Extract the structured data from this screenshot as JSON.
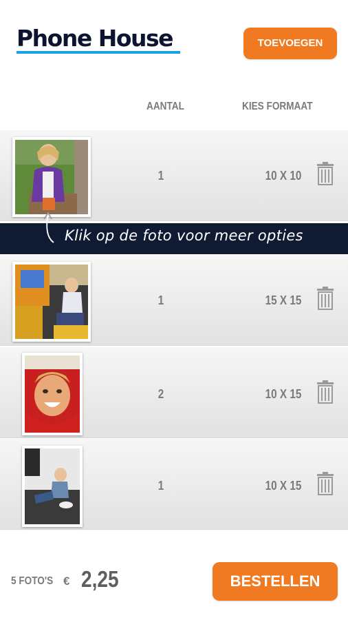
{
  "header": {
    "logo_text": "Phone House",
    "add_button_label": "TOEVOEGEN"
  },
  "columns": {
    "quantity": "AANTAL",
    "format": "KIES FORMAAT"
  },
  "hint": "Klik op de foto voor meer opties",
  "items": [
    {
      "quantity": "1",
      "format": "10 X 10",
      "photo": "girl-purple-jacket"
    },
    {
      "quantity": "1",
      "format": "15 X 15",
      "photo": "child-arcade-game"
    },
    {
      "quantity": "2",
      "format": "10 X 15",
      "photo": "child-red-hood"
    },
    {
      "quantity": "1",
      "format": "10 X 15",
      "photo": "toddler-on-floor"
    }
  ],
  "footer": {
    "photo_count": "5 FOTO'S",
    "currency": "€",
    "total": "2,25",
    "order_button_label": "BESTELLEN"
  },
  "colors": {
    "accent": "#ef7a22",
    "banner": "#0f1a33",
    "logo_underline": "#1aa0e0"
  }
}
